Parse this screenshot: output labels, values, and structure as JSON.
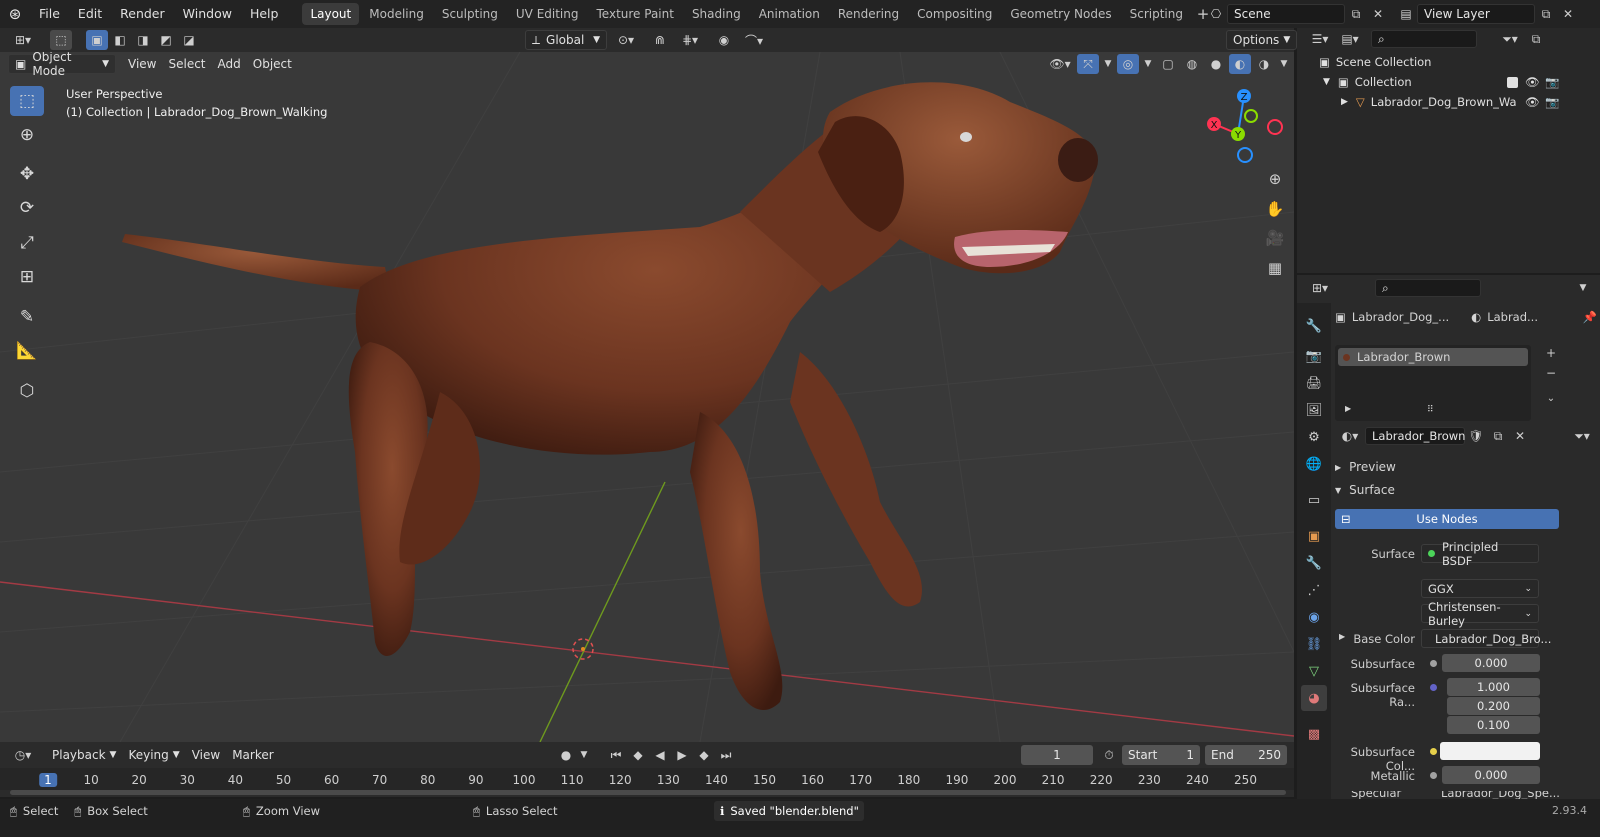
{
  "app": {
    "version": "2.93.4"
  },
  "topbar": {
    "menus": [
      "File",
      "Edit",
      "Render",
      "Window",
      "Help"
    ],
    "workspaces": [
      "Layout",
      "Modeling",
      "Sculpting",
      "UV Editing",
      "Texture Paint",
      "Shading",
      "Animation",
      "Rendering",
      "Compositing",
      "Geometry Nodes",
      "Scripting"
    ],
    "active_workspace": "Layout",
    "scene_name": "Scene",
    "view_layer": "View Layer"
  },
  "tool_header": {
    "transform_orientation": "Global",
    "options_label": "Options"
  },
  "viewport_header": {
    "mode": "Object Mode",
    "menus": [
      "View",
      "Select",
      "Add",
      "Object"
    ]
  },
  "viewport": {
    "perspective_label": "User Perspective",
    "collection_label": "(1) Collection | Labrador_Dog_Brown_Walking",
    "gizmo_axes": {
      "x": "X",
      "y": "Y",
      "z": "Z"
    },
    "colors": {
      "x_axis": "#ff3352",
      "y_axis": "#8bdc00",
      "z_axis": "#2890ff",
      "dog_fur": "#6b3420"
    }
  },
  "outliner": {
    "root": "Scene Collection",
    "collection": "Collection",
    "object": "Labrador_Dog_Brown_Wa"
  },
  "properties": {
    "object_name": "Labrador_Dog_...",
    "material_short": "Labrad...",
    "material_slot": "Labrador_Brown",
    "material_name": "Labrador_Brown",
    "panels": {
      "preview": "Preview",
      "surface": "Surface"
    },
    "use_nodes": "Use Nodes",
    "surface_label": "Surface",
    "surface_value": "Principled BSDF",
    "distribution": "GGX",
    "subsurface_method": "Christensen-Burley",
    "base_color_label": "Base Color",
    "base_color_value": "Labrador_Dog_Bro...",
    "subsurface_label": "Subsurface",
    "subsurface_value": "0.000",
    "subsurface_radius_label": "Subsurface Ra...",
    "subsurface_radius": [
      "1.000",
      "0.200",
      "0.100"
    ],
    "subsurface_color_label": "Subsurface Col...",
    "metallic_label": "Metallic",
    "metallic_value": "0.000",
    "specular_label": "Specular",
    "specular_value": "Labrador_Dog_Spe..."
  },
  "timeline": {
    "menus": [
      "Playback",
      "Keying",
      "View",
      "Marker"
    ],
    "current_frame": "1",
    "start_label": "Start",
    "start_value": "1",
    "end_label": "End",
    "end_value": "250",
    "ticks": [
      "1",
      "10",
      "20",
      "30",
      "40",
      "50",
      "60",
      "70",
      "80",
      "90",
      "100",
      "110",
      "120",
      "130",
      "140",
      "150",
      "160",
      "170",
      "180",
      "190",
      "200",
      "210",
      "220",
      "230",
      "240",
      "250"
    ]
  },
  "statusbar": {
    "select": "Select",
    "box_select": "Box Select",
    "zoom_view": "Zoom View",
    "lasso_select": "Lasso Select",
    "message": "Saved \"blender.blend\""
  }
}
